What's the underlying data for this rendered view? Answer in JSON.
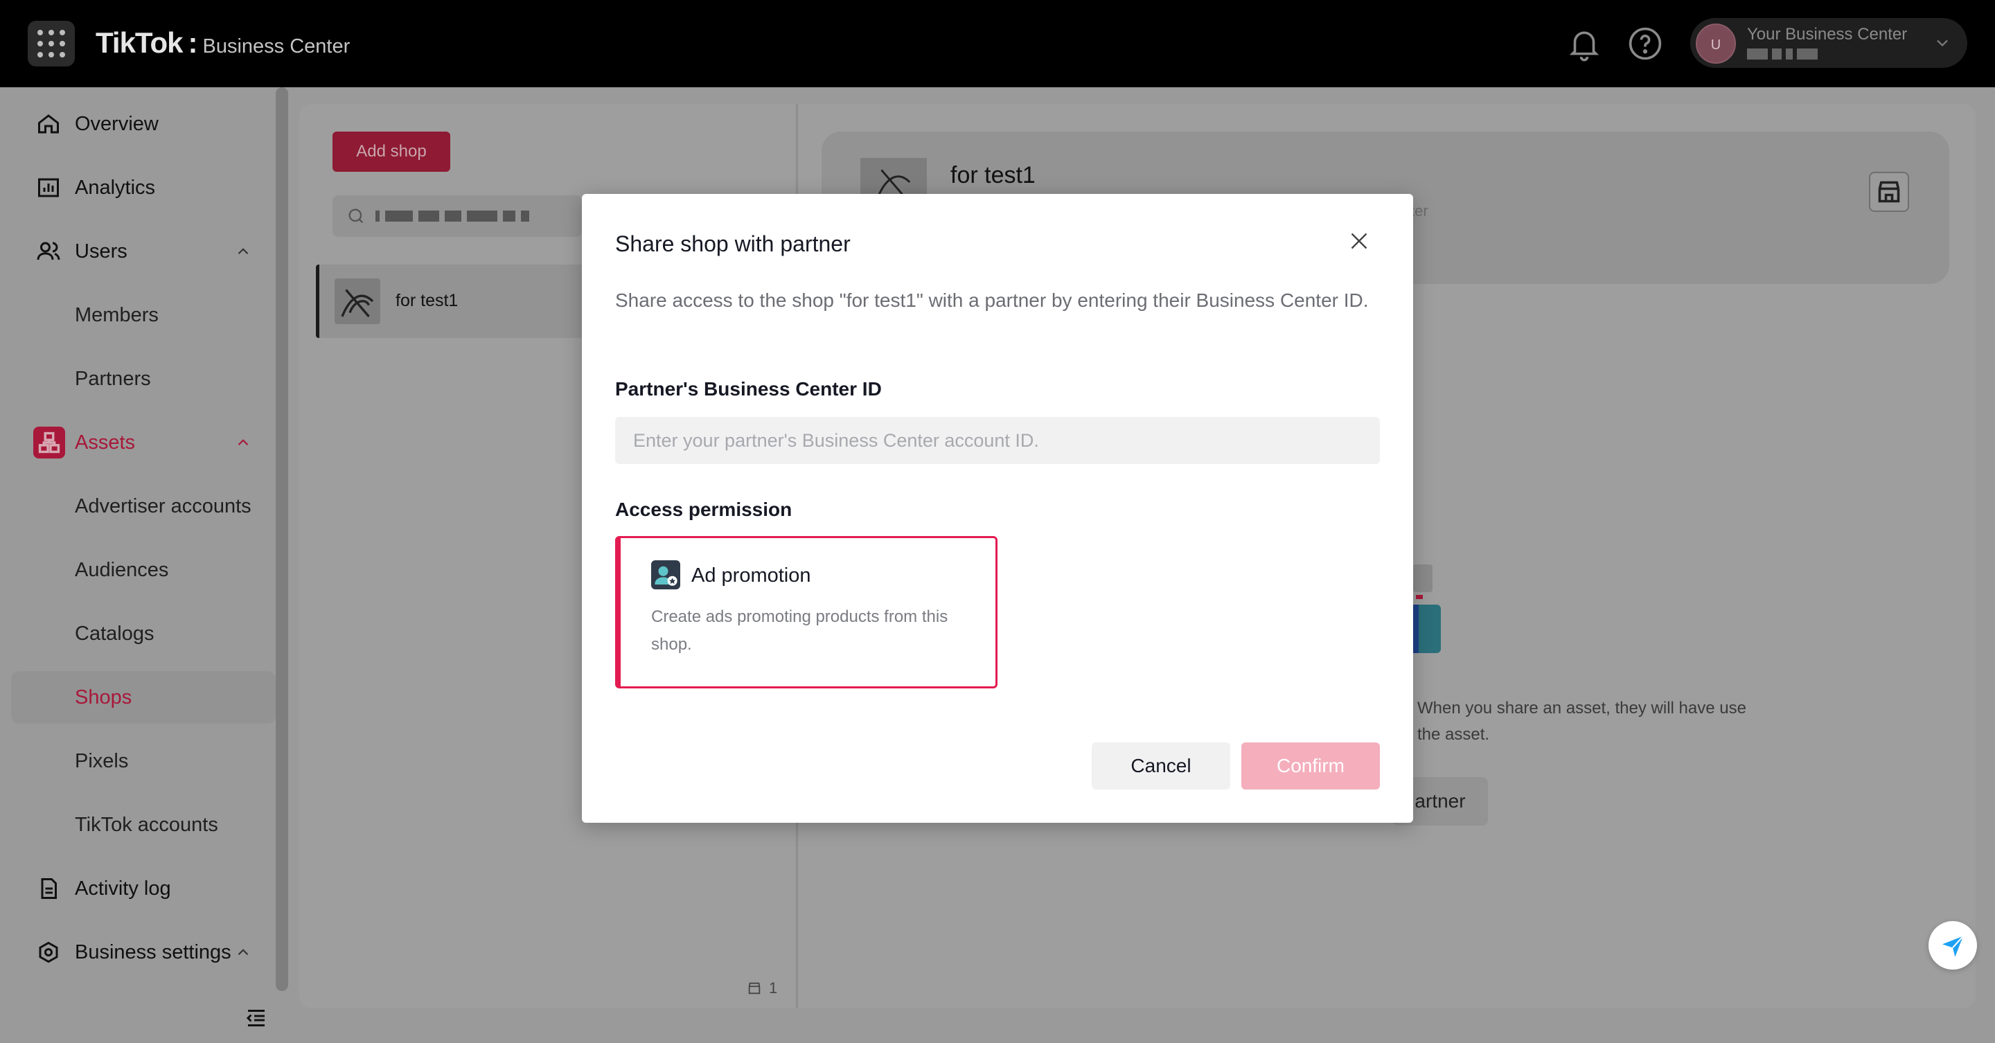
{
  "topbar": {
    "brand": "TikTok",
    "brand_sub": "Business Center",
    "account_name": "Your Business Center",
    "avatar_initial": "U"
  },
  "sidebar": {
    "items": [
      {
        "label": "Overview",
        "icon": "home-icon"
      },
      {
        "label": "Analytics",
        "icon": "chart-icon"
      },
      {
        "label": "Users",
        "icon": "users-icon"
      },
      {
        "label": "Members"
      },
      {
        "label": "Partners"
      },
      {
        "label": "Assets",
        "icon": "assets-icon"
      },
      {
        "label": "Advertiser accounts"
      },
      {
        "label": "Audiences"
      },
      {
        "label": "Catalogs"
      },
      {
        "label": "Shops"
      },
      {
        "label": "Pixels"
      },
      {
        "label": "TikTok accounts"
      },
      {
        "label": "Activity log",
        "icon": "document-icon"
      },
      {
        "label": "Business settings",
        "icon": "settings-icon"
      }
    ],
    "selected": "Shops"
  },
  "shops_panel": {
    "add_button": "Add shop",
    "shops": [
      {
        "name": "for test1"
      }
    ],
    "count": "1"
  },
  "detail": {
    "title": "for test1",
    "sub_fragment": "ter",
    "desc": "When you share an asset, they will have use the asset.",
    "partner_button_fragment": "artner"
  },
  "modal": {
    "title": "Share shop with partner",
    "description": "Share access to the shop \"for test1\" with a partner by entering their Business Center ID.",
    "id_label": "Partner's Business Center ID",
    "id_placeholder": "Enter your partner's Business Center account ID.",
    "id_value": "",
    "permission_label": "Access permission",
    "permission": {
      "title": "Ad promotion",
      "description": "Create ads promoting products from this shop.",
      "selected": true
    },
    "cancel_label": "Cancel",
    "confirm_label": "Confirm"
  },
  "colors": {
    "accent": "#E31C51",
    "confirm_disabled": "#F4AEBC",
    "overlay": "#9A9A9A"
  }
}
